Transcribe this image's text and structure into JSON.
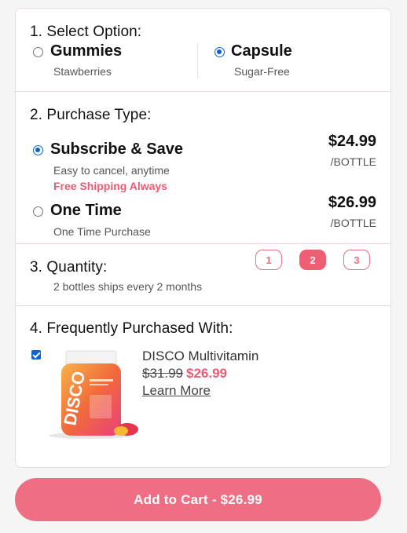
{
  "colors": {
    "accent": "#ee5a6f",
    "radio_checked": "#0b63ce",
    "cart_button": "#ee6f84"
  },
  "section1": {
    "title": "1. Select Option:",
    "options": [
      {
        "label": "Gummies",
        "sub": "Stawberries",
        "selected": false
      },
      {
        "label": "Capsule",
        "sub": "Sugar-Free",
        "selected": true
      }
    ]
  },
  "section2": {
    "title": "2. Purchase Type:",
    "options": [
      {
        "label": "Subscribe & Save",
        "sub": "Easy to cancel, anytime",
        "note": "Free Shipping Always",
        "price": "$24.99",
        "per": "/BOTTLE",
        "selected": true
      },
      {
        "label": "One Time",
        "sub": "One Time Purchase",
        "price": "$26.99",
        "per": "/BOTTLE",
        "selected": false
      }
    ]
  },
  "section3": {
    "title": "3. Quantity:",
    "sub": "2 bottles ships every 2 months",
    "options": [
      "1",
      "2",
      "3"
    ],
    "selected": "2"
  },
  "section4": {
    "title": "4. Frequently Purchased With:",
    "product": {
      "name": "DISCO Multivitamin",
      "old_price": "$31.99",
      "new_price": "$26.99",
      "link": "Learn More",
      "checked": true,
      "icon": "vitamin-bottle-image"
    }
  },
  "cart": {
    "label": "Add to Cart - $26.99"
  }
}
